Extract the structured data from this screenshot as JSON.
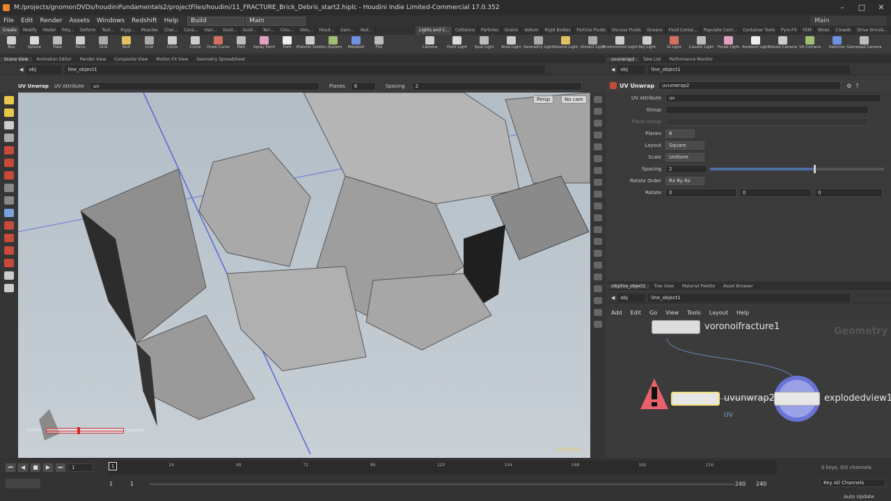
{
  "title": "M:/projects/gnomonDVDs/houdiniFundamentals2/projectFiles/houdini/11_FRACTURE_Brick_Debris_start2.hiplc - Houdini Indie Limited-Commercial 17.0.352",
  "menu": [
    "File",
    "Edit",
    "Render",
    "Assets",
    "Windows",
    "Redshift",
    "Help"
  ],
  "desktop": "Build",
  "desktop2": "Main",
  "desktop_right": "Main",
  "shelf_left_tabs": [
    "Create",
    "Modify",
    "Model",
    "Poly...",
    "Deform",
    "Text...",
    "Riggi...",
    "Muscles",
    "Char...",
    "Cons...",
    "Hair...",
    "Guid...",
    "Guid...",
    "Terr...",
    "Clou...",
    "Volu...",
    "Houd...",
    "Gam...",
    "Red..."
  ],
  "shelf_left_tools": [
    "Box",
    "Sphere",
    "Tube",
    "Torus",
    "Grid",
    "Null",
    "Line",
    "Circle",
    "Curve",
    "Draw Curve",
    "Path",
    "Spray Paint",
    "Font",
    "Platonic Solids",
    "L-System",
    "Metaball",
    "File"
  ],
  "shelf_right_tabs": [
    "Lights and C...",
    "Collisions",
    "Particles",
    "Grains",
    "Vellum",
    "Rigid Bodies",
    "Particle Fluids",
    "Viscous Fluids",
    "Oceans",
    "Fluid Contai...",
    "Populate Cont...",
    "Container Tools",
    "Pyro FX",
    "FEM",
    "Wires",
    "Crowds",
    "Drive Simula..."
  ],
  "shelf_right_tools": [
    "Camera",
    "Point Light",
    "Spot Light",
    "Area Light",
    "Geometry Light",
    "Volume Light",
    "Distant Light",
    "Environment Light",
    "Sky Light",
    "GI Light",
    "Caustic Light",
    "Portal Light",
    "Ambient Light",
    "Stereo Camera",
    "VR Camera",
    "Switcher",
    "Gamepad Camera"
  ],
  "viewer_tabs": [
    "Scene View",
    "Animation Editor",
    "Render View",
    "Composite View",
    "Motion FX View",
    "Geometry Spreadsheet"
  ],
  "path_obj": "obj",
  "path_node": "line_object1",
  "opbar": {
    "op": "UV Unwrap",
    "attr_label": "UV Attribute",
    "attr_value": "uv",
    "planes_label": "Planes",
    "planes_value": "6",
    "spacing_label": "Spacing",
    "spacing_value": "2"
  },
  "viewport": {
    "persp": "Persp",
    "cam": "No cam",
    "handle_value": "2.0000",
    "handle_label": "Spacing",
    "edition": "Indie Edition"
  },
  "params_tabs": [
    "uvunwrap2",
    "Take List",
    "Performance Monitor"
  ],
  "params_header": {
    "op": "UV Unwrap",
    "name": "uvunwrap2"
  },
  "params": {
    "uv_attribute": {
      "label": "UV Attribute",
      "value": "uv"
    },
    "group": {
      "label": "Group",
      "value": ""
    },
    "plane_group": {
      "label": "Plane Group",
      "value": ""
    },
    "planes": {
      "label": "Planes",
      "value": "6"
    },
    "layout": {
      "label": "Layout",
      "value": "Square"
    },
    "scale": {
      "label": "Scale",
      "value": "Uniform"
    },
    "spacing": {
      "label": "Spacing",
      "value": "2",
      "slider_fraction": 0.6
    },
    "rotate_order": {
      "label": "Rotate Order",
      "value": "Rx Ry Rz"
    },
    "rotate": {
      "label": "Rotate",
      "x": "0",
      "y": "0",
      "z": "0"
    }
  },
  "net_tabs": [
    "/obj/line_object1",
    "Tree View",
    "Material Palette",
    "Asset Browser"
  ],
  "net_menu": [
    "Add",
    "Edit",
    "Go",
    "View",
    "Tools",
    "Layout",
    "Help"
  ],
  "nodes": {
    "voronoi": "voronoifracture1",
    "uvunwrap": "uvunwrap2",
    "exploded": "explodedview1",
    "uv_flag": "UV",
    "context": "Geometry"
  },
  "timeline": {
    "frame": "1",
    "ticks": [
      "1",
      "24",
      "48",
      "72",
      "96",
      "120",
      "144",
      "168",
      "192",
      "216"
    ],
    "start": "1",
    "start2": "1",
    "end": "240",
    "end2": "240",
    "keys": "0 keys, 0/0 channels",
    "key_all": "Key All Channels",
    "auto_update": "Auto Update"
  },
  "colors": {
    "accent": "#e8862a",
    "node_select": "#f3e27a",
    "warning": "#e8616b",
    "blue_ring": "#6a74d6"
  }
}
